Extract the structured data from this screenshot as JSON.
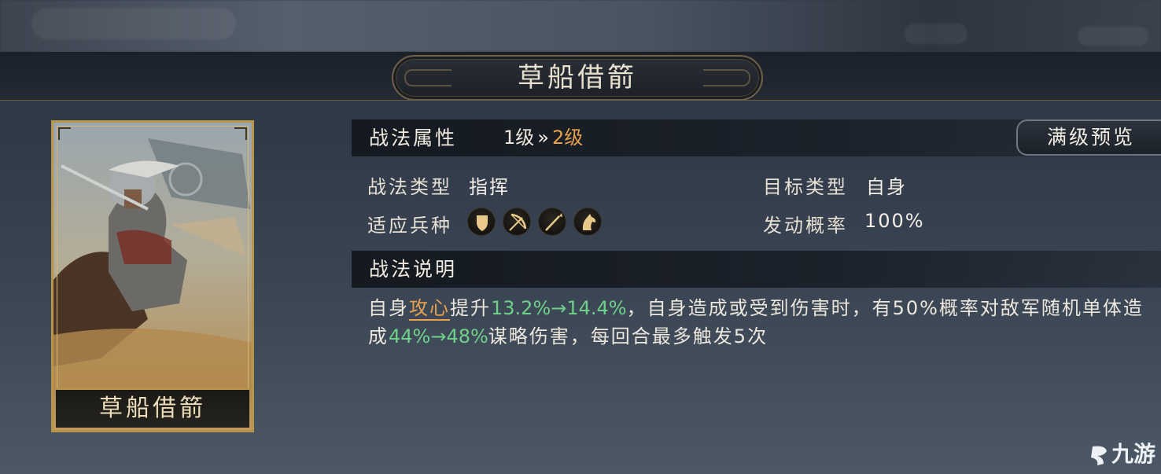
{
  "title": "草船借箭",
  "card": {
    "name": "草船借箭"
  },
  "attributes": {
    "header": "战法属性",
    "level_from": "1级",
    "level_arrow": "»",
    "level_to": "2级",
    "preview_button": "满级预览",
    "type_label": "战法类型",
    "type_value": "指挥",
    "target_label": "目标类型",
    "target_value": "自身",
    "troops_label": "适应兵种",
    "troops": [
      "shield-icon",
      "bow-icon",
      "spear-icon",
      "horse-icon"
    ],
    "chance_label": "发动概率",
    "chance_value": "100%"
  },
  "description": {
    "header": "战法说明",
    "t1": "自身",
    "keyword": "攻心",
    "t2": "提升",
    "v1": "13.2%→14.4%",
    "t3": "，自身造成或受到伤害时，有50%概率对敌军随机单体造成",
    "v2": "44%→48%",
    "t4": "谋略伤害，每回合最多触发5次"
  },
  "watermark": "九游",
  "colors": {
    "accent_orange": "#e7a14d",
    "value_green": "#6fd08a",
    "gold_frame": "#b89548"
  }
}
